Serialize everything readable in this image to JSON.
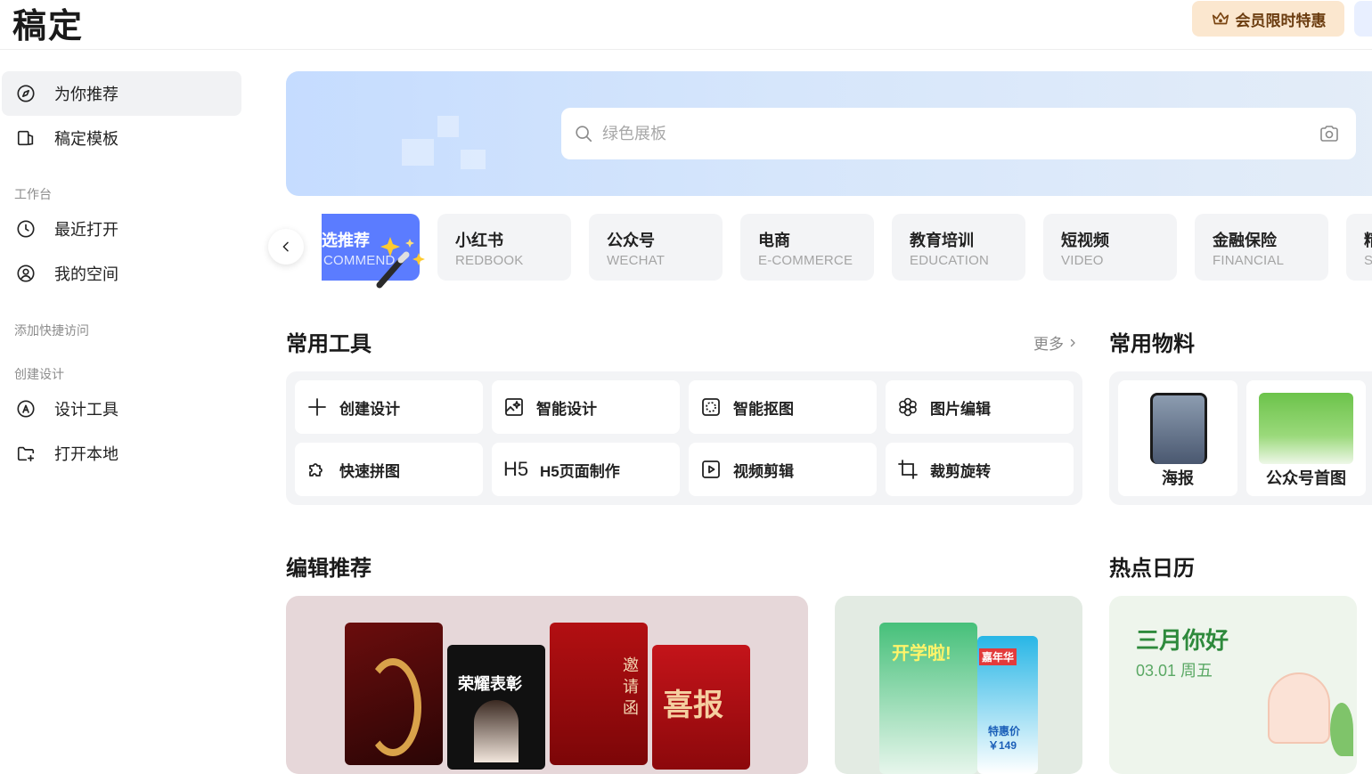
{
  "header": {
    "logo": "稿定",
    "vip_label": "会员限时特惠"
  },
  "sidebar": {
    "items": [
      {
        "label": "为你推荐",
        "icon": "compass-icon",
        "active": true
      },
      {
        "label": "稿定模板",
        "icon": "template-icon",
        "active": false
      }
    ],
    "workspace_label": "工作台",
    "workspace_items": [
      {
        "label": "最近打开",
        "icon": "clock-icon"
      },
      {
        "label": "我的空间",
        "icon": "user-circle-icon"
      }
    ],
    "quick_access_label": "添加快捷访问",
    "create_label": "创建设计",
    "create_items": [
      {
        "label": "设计工具",
        "icon": "pen-nib-icon"
      },
      {
        "label": "打开本地",
        "icon": "folder-plus-icon"
      }
    ]
  },
  "search": {
    "placeholder": "绿色展板"
  },
  "categories": [
    {
      "cn": "选推荐",
      "en": "COMMEND",
      "active": true
    },
    {
      "cn": "小红书",
      "en": "REDBOOK"
    },
    {
      "cn": "公众号",
      "en": "WECHAT"
    },
    {
      "cn": "电商",
      "en": "E-COMMERCE"
    },
    {
      "cn": "教育培训",
      "en": "EDUCATION"
    },
    {
      "cn": "短视频",
      "en": "VIDEO"
    },
    {
      "cn": "金融保险",
      "en": "FINANCIAL"
    },
    {
      "cn": "精",
      "en": "S"
    }
  ],
  "tools_section": {
    "title": "常用工具",
    "more_label": "更多",
    "items": [
      {
        "label": "创建设计",
        "icon": "plus-icon"
      },
      {
        "label": "智能设计",
        "icon": "ai-design-icon"
      },
      {
        "label": "智能抠图",
        "icon": "cutout-icon"
      },
      {
        "label": "图片编辑",
        "icon": "image-edit-icon"
      },
      {
        "label": "快速拼图",
        "icon": "puzzle-icon"
      },
      {
        "label": "H5页面制作",
        "icon": "h5-icon",
        "icon_text": "H5"
      },
      {
        "label": "视频剪辑",
        "icon": "video-play-icon"
      },
      {
        "label": "裁剪旋转",
        "icon": "crop-icon"
      }
    ]
  },
  "materials_section": {
    "title": "常用物料",
    "items": [
      {
        "label": "海报"
      },
      {
        "label": "公众号首图"
      }
    ]
  },
  "editor_section": {
    "title": "编辑推荐",
    "poster_texts": [
      "荣耀表彰",
      "邀请函",
      "喜报",
      "开学啦!",
      "嘉年华",
      "特惠价",
      "￥149"
    ]
  },
  "calendar_section": {
    "title": "热点日历",
    "card_title": "三月你好",
    "card_date": "03.01 周五"
  },
  "colors": {
    "accent": "#5b7cff",
    "vip_bg": "#fbe7cf",
    "calendar_green": "#2e8a3c"
  }
}
